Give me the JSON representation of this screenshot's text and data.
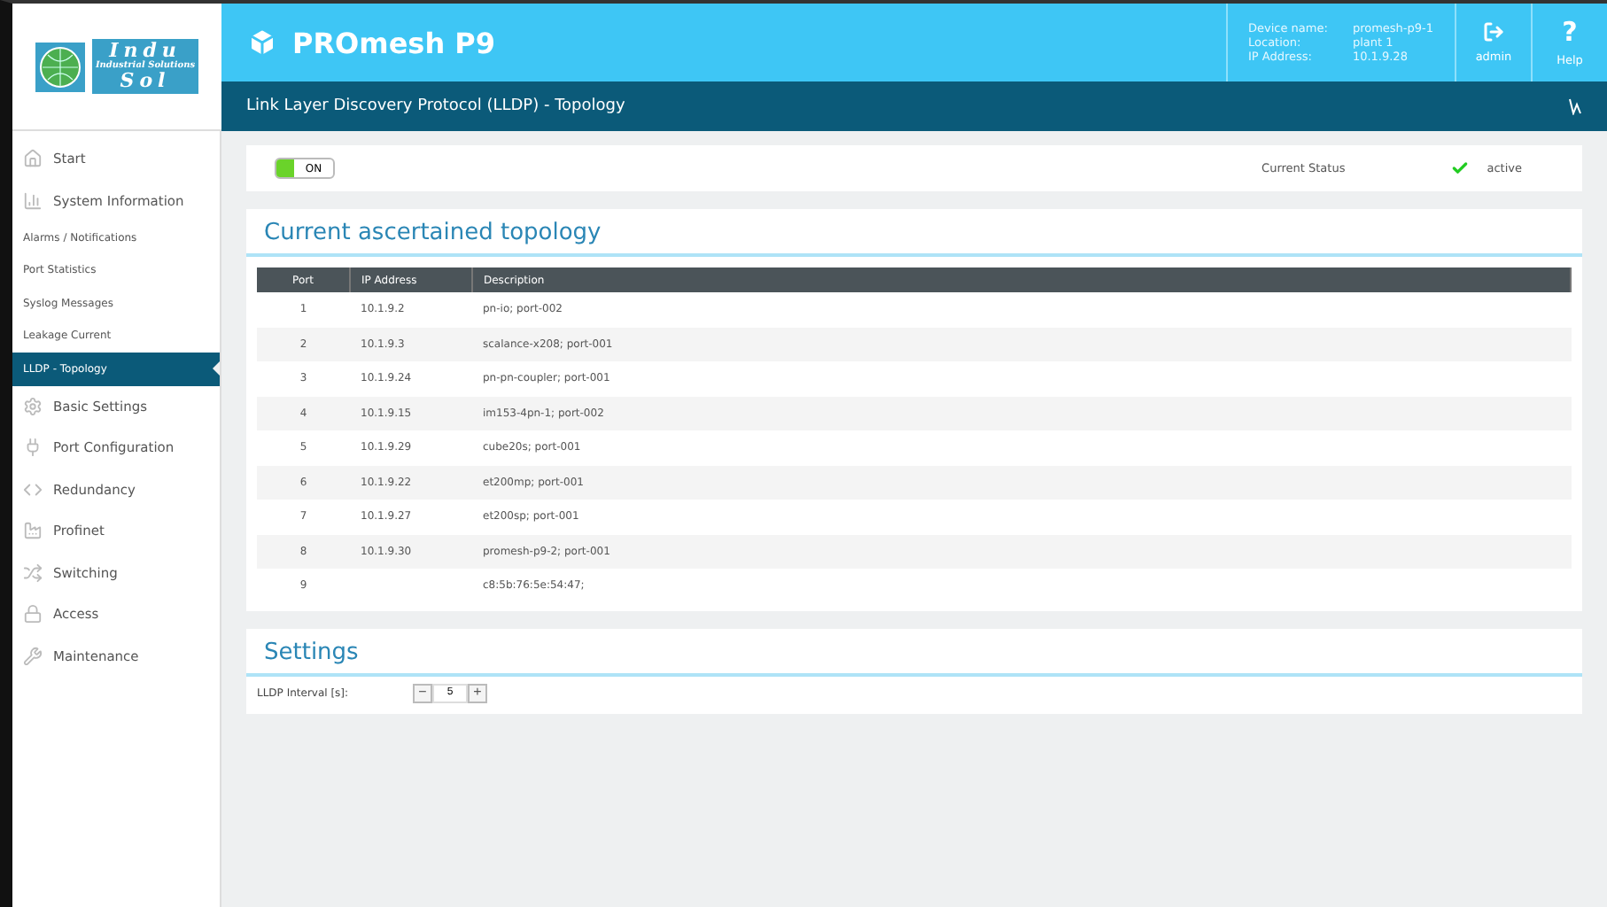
{
  "logo": {
    "top": "Indu",
    "middle": "Industrial Solutions",
    "bottom": "Sol"
  },
  "header": {
    "product": "PROmesh P9",
    "device_info": [
      {
        "label": "Device name:",
        "value": "promesh-p9-1"
      },
      {
        "label": "Location:",
        "value": "plant 1"
      },
      {
        "label": "IP Address:",
        "value": "10.1.9.28"
      }
    ],
    "user": "admin",
    "help_symbol": "?",
    "help": "Help"
  },
  "page_title": "Link Layer Discovery Protocol (LLDP) - Topology",
  "sidebar": {
    "items": [
      {
        "label": "Start",
        "kind": "main",
        "selected": false
      },
      {
        "label": "System Information",
        "kind": "main",
        "selected": false
      },
      {
        "label": "Alarms / Notifications",
        "kind": "sub",
        "selected": false
      },
      {
        "label": "Port Statistics",
        "kind": "sub",
        "selected": false
      },
      {
        "label": "Syslog Messages",
        "kind": "sub",
        "selected": false
      },
      {
        "label": "Leakage Current",
        "kind": "sub",
        "selected": false
      },
      {
        "label": "LLDP - Topology",
        "kind": "sub",
        "selected": true
      },
      {
        "label": "Basic Settings",
        "kind": "main",
        "selected": false
      },
      {
        "label": "Port Configuration",
        "kind": "main",
        "selected": false
      },
      {
        "label": "Redundancy",
        "kind": "main",
        "selected": false
      },
      {
        "label": "Profinet",
        "kind": "main",
        "selected": false
      },
      {
        "label": "Switching",
        "kind": "main",
        "selected": false
      },
      {
        "label": "Access",
        "kind": "main",
        "selected": false
      },
      {
        "label": "Maintenance",
        "kind": "main",
        "selected": false
      }
    ]
  },
  "status_bar": {
    "toggle": {
      "label": "ON",
      "on": true
    },
    "status_label": "Current Status",
    "status_value": "active",
    "status_ok": true
  },
  "topology": {
    "title": "Current ascertained topology",
    "columns": [
      "Port",
      "IP Address",
      "Description"
    ],
    "rows": [
      [
        "1",
        "10.1.9.2",
        "pn-io; port-002"
      ],
      [
        "2",
        "10.1.9.3",
        "scalance-x208; port-001"
      ],
      [
        "3",
        "10.1.9.24",
        "pn-pn-coupler; port-001"
      ],
      [
        "4",
        "10.1.9.15",
        "im153-4pn-1; port-002"
      ],
      [
        "5",
        "10.1.9.29",
        "cube20s; port-001"
      ],
      [
        "6",
        "10.1.9.22",
        "et200mp; port-001"
      ],
      [
        "7",
        "10.1.9.27",
        "et200sp; port-001"
      ],
      [
        "8",
        "10.1.9.30",
        "promesh-p9-2; port-001"
      ],
      [
        "9",
        "",
        "c8:5b:76:5e:54:47;"
      ]
    ]
  },
  "settings": {
    "title": "Settings",
    "fields": [
      {
        "label": "LLDP Interval [s]:",
        "minus": "−",
        "value": "5",
        "plus": "+"
      }
    ]
  }
}
